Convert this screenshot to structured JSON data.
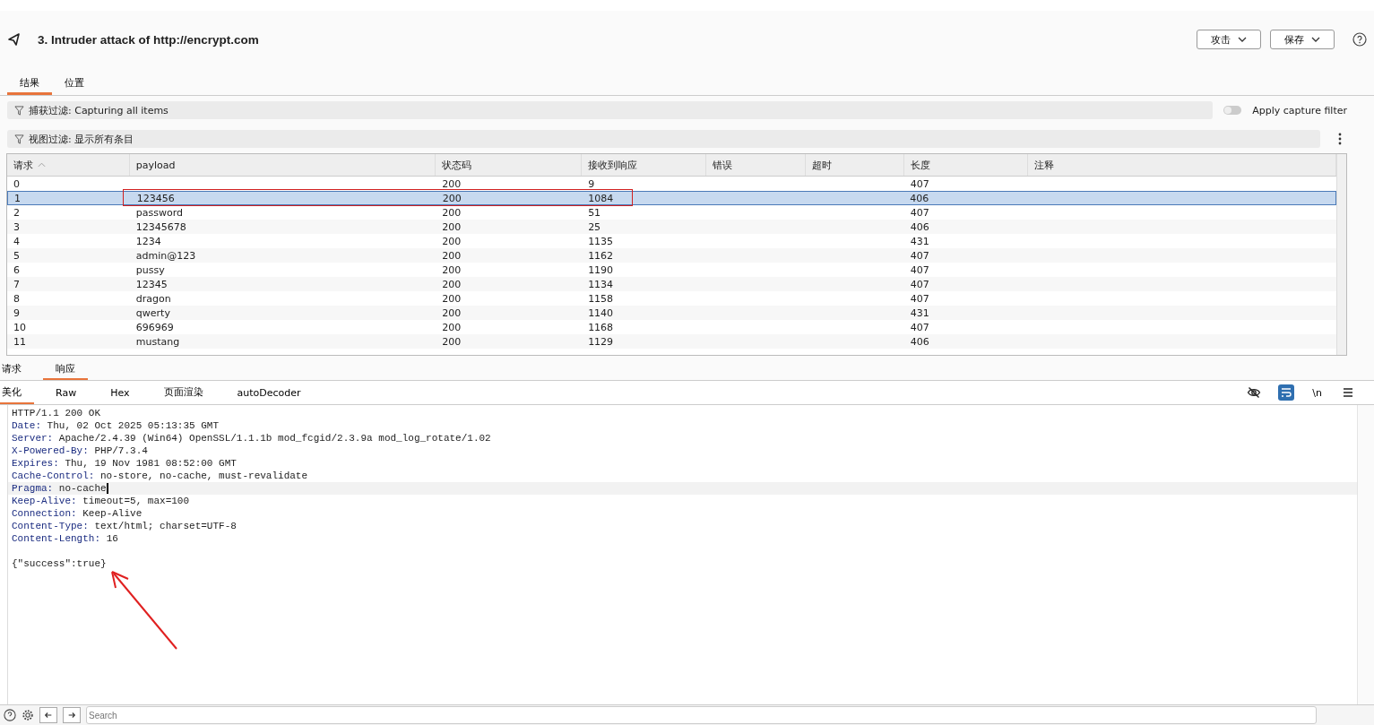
{
  "header": {
    "title": "3. Intruder attack of http://encrypt.com",
    "buttons": [
      {
        "label": "攻击"
      },
      {
        "label": "保存"
      }
    ]
  },
  "tabs": [
    {
      "label": "结果",
      "selected": true
    },
    {
      "label": "位置",
      "selected": false
    }
  ],
  "capture_filter": {
    "label": "捕获过滤: Capturing all items",
    "toggle_label": "Apply capture filter",
    "on": false
  },
  "view_filter": {
    "label": "视图过滤: 显示所有条目"
  },
  "table": {
    "columns": [
      "请求",
      "payload",
      "状态码",
      "接收到响应",
      "错误",
      "超时",
      "长度",
      "注释"
    ],
    "rows": [
      {
        "cells": [
          "0",
          "",
          "200",
          "9",
          "",
          "",
          "407",
          ""
        ],
        "selected": false
      },
      {
        "cells": [
          "1",
          "123456",
          "200",
          "1084",
          "",
          "",
          "406",
          ""
        ],
        "selected": true
      },
      {
        "cells": [
          "2",
          "password",
          "200",
          "51",
          "",
          "",
          "407",
          ""
        ],
        "selected": false
      },
      {
        "cells": [
          "3",
          "12345678",
          "200",
          "25",
          "",
          "",
          "406",
          ""
        ],
        "selected": false
      },
      {
        "cells": [
          "4",
          "1234",
          "200",
          "1135",
          "",
          "",
          "431",
          ""
        ],
        "selected": false
      },
      {
        "cells": [
          "5",
          "admin@123",
          "200",
          "1162",
          "",
          "",
          "407",
          ""
        ],
        "selected": false
      },
      {
        "cells": [
          "6",
          "pussy",
          "200",
          "1190",
          "",
          "",
          "407",
          ""
        ],
        "selected": false
      },
      {
        "cells": [
          "7",
          "12345",
          "200",
          "1134",
          "",
          "",
          "407",
          ""
        ],
        "selected": false
      },
      {
        "cells": [
          "8",
          "dragon",
          "200",
          "1158",
          "",
          "",
          "407",
          ""
        ],
        "selected": false
      },
      {
        "cells": [
          "9",
          "qwerty",
          "200",
          "1140",
          "",
          "",
          "431",
          ""
        ],
        "selected": false
      },
      {
        "cells": [
          "10",
          "696969",
          "200",
          "1168",
          "",
          "",
          "407",
          ""
        ],
        "selected": false
      },
      {
        "cells": [
          "11",
          "mustang",
          "200",
          "1129",
          "",
          "",
          "406",
          ""
        ],
        "selected": false
      }
    ]
  },
  "message_tabs": [
    {
      "label": "请求",
      "selected": false
    },
    {
      "label": "响应",
      "selected": true
    }
  ],
  "view_tabs": [
    {
      "label": "美化",
      "selected": true
    },
    {
      "label": "Raw",
      "selected": false
    },
    {
      "label": "Hex",
      "selected": false
    },
    {
      "label": "页面渲染",
      "selected": false
    },
    {
      "label": "autoDecoder",
      "selected": false
    }
  ],
  "editor_tools": [
    {
      "kind": "hide",
      "active": false
    },
    {
      "kind": "wrap",
      "active": true
    },
    {
      "kind": "newline",
      "label": "\\n",
      "active": false
    },
    {
      "kind": "menu",
      "active": false
    }
  ],
  "response_lines": [
    {
      "text": "HTTP/1.1 200 OK",
      "current": false
    },
    {
      "key": "Date:",
      "text": " Thu, 02 Oct 2025 05:13:35 GMT",
      "current": false
    },
    {
      "key": "Server:",
      "text": " Apache/2.4.39 (Win64) OpenSSL/1.1.1b mod_fcgid/2.3.9a mod_log_rotate/1.02",
      "current": false
    },
    {
      "key": "X-Powered-By:",
      "text": " PHP/7.3.4",
      "current": false
    },
    {
      "key": "Expires:",
      "text": " Thu, 19 Nov 1981 08:52:00 GMT",
      "current": false
    },
    {
      "key": "Cache-Control:",
      "text": " no-store, no-cache, must-revalidate",
      "current": false
    },
    {
      "key": "Pragma:",
      "text": " no-cache",
      "current": true
    },
    {
      "key": "Keep-Alive:",
      "text": " timeout=5, max=100",
      "current": false
    },
    {
      "key": "Connection:",
      "text": " Keep-Alive",
      "current": false
    },
    {
      "key": "Content-Type:",
      "text": " text/html; charset=UTF-8",
      "current": false
    },
    {
      "key": "Content-Length:",
      "text": " 16",
      "current": false
    },
    {
      "current": false
    },
    {
      "text": "{\"success\":true}",
      "current": false
    }
  ],
  "search": {
    "placeholder": "Search"
  }
}
